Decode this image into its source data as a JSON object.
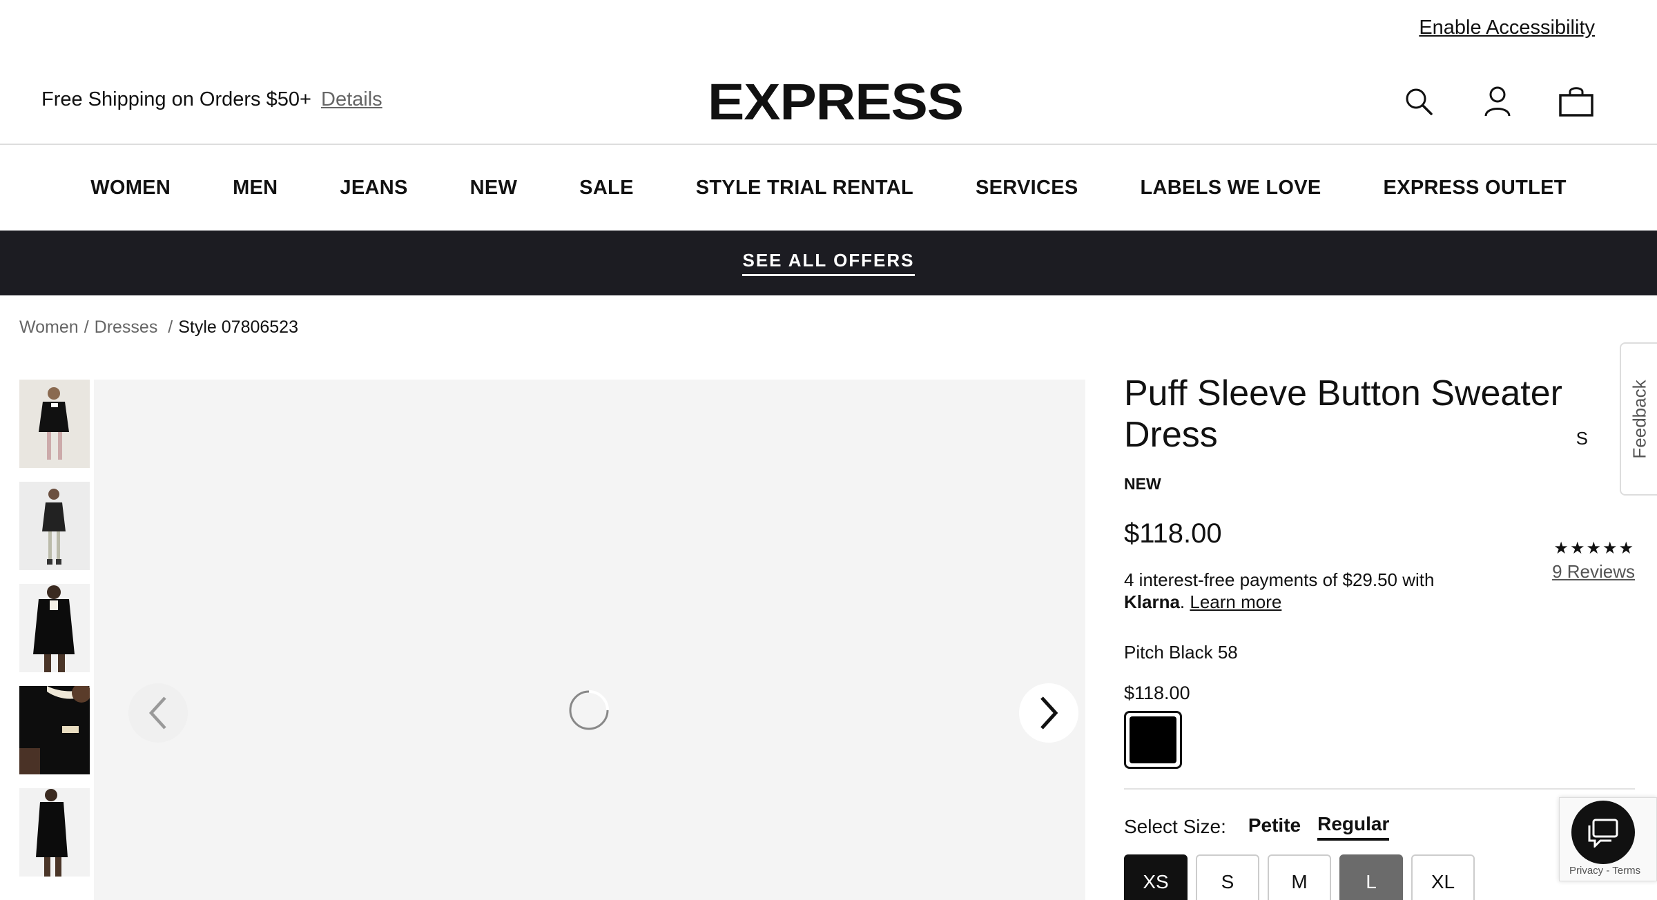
{
  "top": {
    "accessibility_link": "Enable Accessibility"
  },
  "header": {
    "promo": "Free Shipping on Orders $50+",
    "promo_link": "Details",
    "logo": "EXPRESS",
    "icons": [
      "search-icon",
      "account-icon",
      "bag-icon"
    ]
  },
  "nav": {
    "items": [
      "WOMEN",
      "MEN",
      "JEANS",
      "NEW",
      "SALE",
      "STYLE TRIAL RENTAL",
      "SERVICES",
      "LABELS WE LOVE",
      "EXPRESS OUTLET"
    ]
  },
  "offers_bar": {
    "label": "SEE ALL OFFERS",
    "bg_color": "#1c1c22"
  },
  "breadcrumb": {
    "items": [
      "Women",
      "Dresses"
    ],
    "current": "Style 07806523"
  },
  "product": {
    "title": "Puff Sleeve Button Sweater Dress",
    "badge": "NEW",
    "price": "$118.00",
    "rating": {
      "stars": "★★★★★",
      "reviews": "9 Reviews",
      "value": 5
    },
    "klarna": {
      "text": "4 interest-free payments of $29.50 with",
      "brand": "Klarna",
      "learn_more": "Learn more"
    },
    "color_name": "Pitch Black 58",
    "color_price": "$118.00",
    "swatch_color": "#000000",
    "size_label": "Select Size:",
    "fits": [
      "Petite",
      "Regular"
    ],
    "active_fit": "Regular",
    "sizes": [
      "XS",
      "S",
      "M",
      "L",
      "XL"
    ],
    "selected_size": "XS",
    "unavailable_size": "L",
    "cut_text": "S"
  },
  "feedback_tab": "Feedback",
  "captcha_terms": "Privacy - Terms"
}
